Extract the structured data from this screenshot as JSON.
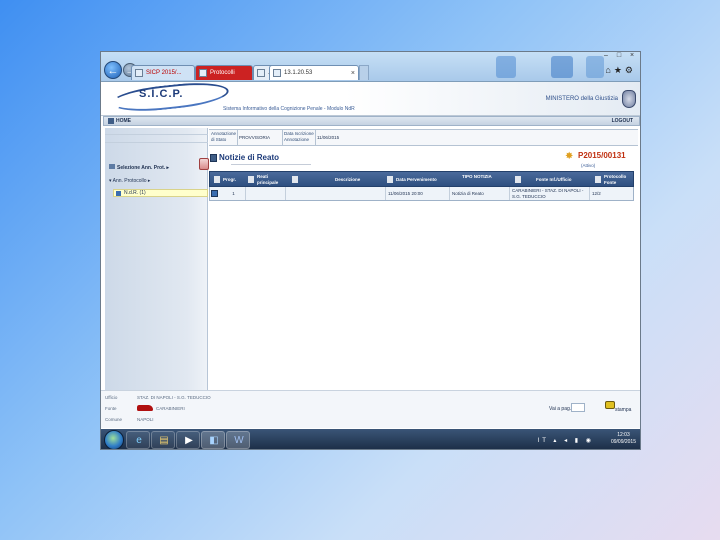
{
  "browser": {
    "tabs": [
      {
        "label": "SICP 2015/..."
      },
      {
        "label": "Protocolli"
      },
      {
        "label": "..."
      },
      {
        "label": "13.1.20.53"
      }
    ],
    "window_controls": [
      "–",
      "□",
      "×"
    ],
    "toolbar_icons": [
      "home-icon",
      "star-icon",
      "gear-icon"
    ]
  },
  "app": {
    "logo": "S.I.C.P.",
    "subtitle": "Sistema Informativo della Cognizione Penale - Modulo NdR",
    "ministry": "MINISTERO della Giustizia"
  },
  "topbar": {
    "home_label": "HOME",
    "logout_label": "LOGOUT"
  },
  "sidebar": {
    "select_label": "Selezione Ann. Prot.",
    "annotation_label": "Ann. Protocollo",
    "nr_label": "N.d.R. (1)"
  },
  "info": {
    "label1": "Annotazione di Stato",
    "value1": "PROVVISORIA",
    "label2": "Data Iscrizione Annotazione",
    "value2": "11/06/2015"
  },
  "notizie": {
    "title": "Notizie di Reato",
    "protocol": "P2015/00131",
    "status": "(Attivo)"
  },
  "table": {
    "columns": [
      "Progr.",
      "Reati principale",
      "Descrizione",
      "Data Pervenimento",
      "TIPO NOTIZIA",
      "Fonte Inf./Ufficio",
      "Protocollo Fonte"
    ],
    "rows": [
      {
        "progr": "1",
        "reati": "",
        "descrizione": "",
        "data": "11/06/2015 20:00",
        "tipo": "Notizia di Reato",
        "fonte": "CARABINIERI - STAZ. DI NAPOLI - S.G. TEDUCCIO",
        "protocollo": "12/2"
      }
    ]
  },
  "footer": {
    "ufficio_label": "Ufficio",
    "ufficio_value": "STAZ. DI NAPOLI - S.G. TEDUCCIO",
    "fonte_label": "Fonte",
    "fonte_value": "CARABINIERI",
    "comune_label": "Comune",
    "comune_value": "NAPOLI",
    "vai_label": "Vai a pag.",
    "print_label": "stampa"
  },
  "taskbar": {
    "apps": [
      "ie-icon",
      "folder-icon",
      "media-icon",
      "explorer-icon",
      "word-icon"
    ],
    "tray": "IT",
    "time": "12:03",
    "date": "09/09/2015"
  }
}
